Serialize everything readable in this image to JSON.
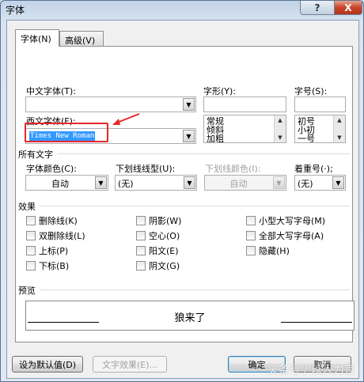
{
  "window": {
    "title": "字体",
    "help": "?",
    "close": "X"
  },
  "tabs": [
    {
      "label": "字体(N)"
    },
    {
      "label": "高级(V)"
    }
  ],
  "chinese_font": {
    "label": "中文字体(T):",
    "value": ""
  },
  "western_font": {
    "label": "西文字体(F):",
    "value": "Times New Roman"
  },
  "style": {
    "label": "字形(Y):",
    "value": "",
    "options": [
      "常规",
      "倾斜",
      "加粗"
    ]
  },
  "size": {
    "label": "字号(S):",
    "value": "",
    "options": [
      "初号",
      "小初",
      "一号"
    ]
  },
  "all_text": {
    "heading": "所有文字"
  },
  "font_color": {
    "label": "字体颜色(C):",
    "value": "自动"
  },
  "underline_type": {
    "label": "下划线线型(U):",
    "value": "(无)"
  },
  "underline_color": {
    "label": "下划线颜色(I):",
    "value": "自动"
  },
  "emphasis": {
    "label": "着重号(·);",
    "value": "(无)"
  },
  "effects": {
    "heading": "效果",
    "items": [
      "删除线(K)",
      "双删除线(L)",
      "上标(P)",
      "下标(B)",
      "阴影(W)",
      "空心(O)",
      "阳文(E)",
      "阴文(G)",
      "小型大写字母(M)",
      "全部大写字母(A)",
      "隐藏(H)"
    ]
  },
  "preview": {
    "heading": "预览",
    "text": "狼来了"
  },
  "buttons": {
    "set_default": "设为默认值(D)",
    "text_effects": "文字效果(E)...",
    "ok": "确定",
    "cancel": "取消"
  },
  "watermark": "头条号 / 以人为言",
  "colors": {
    "annotation_red": "#e8262a",
    "selection_blue": "#3399ff",
    "close_red": "#c7452b"
  }
}
